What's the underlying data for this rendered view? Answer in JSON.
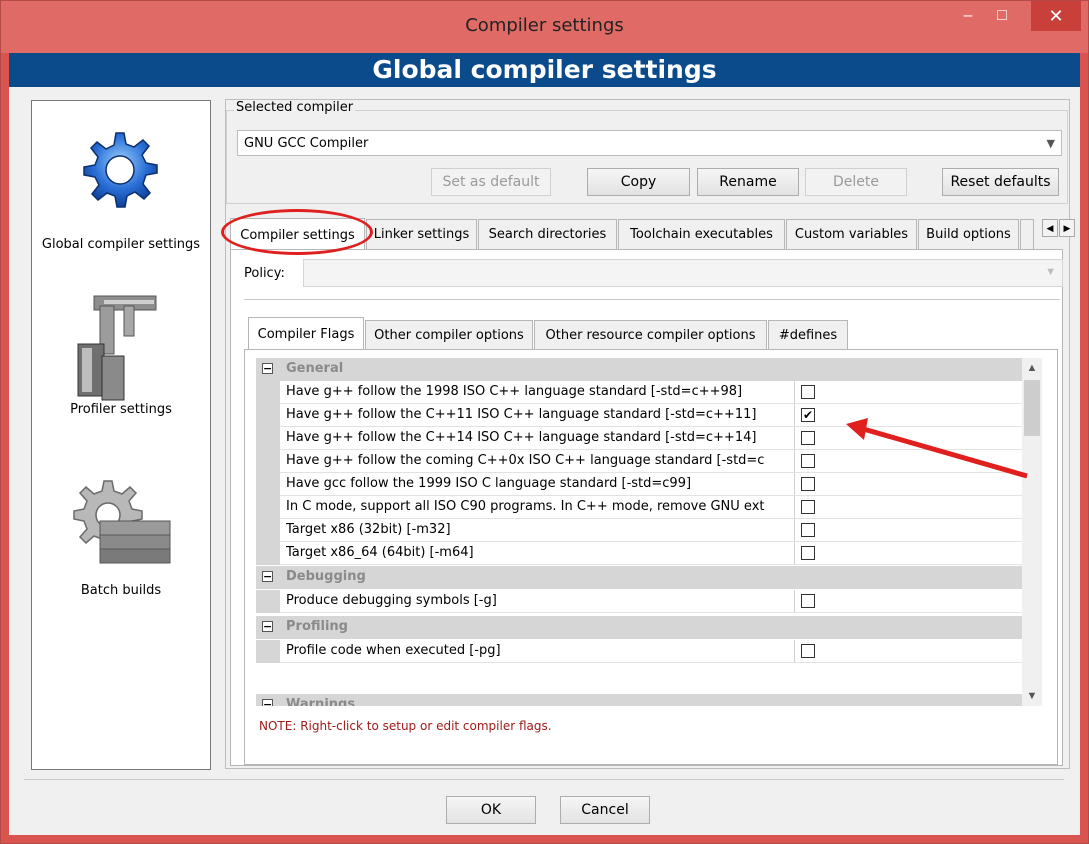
{
  "window": {
    "title": "Compiler settings",
    "header": "Global compiler settings",
    "controls": {
      "minimize": "–",
      "maximize": "□",
      "close": "✕"
    }
  },
  "sidebar": {
    "items": [
      {
        "label": "Global compiler settings",
        "icon": "gear-icon"
      },
      {
        "label": "Profiler settings",
        "icon": "caliper-icon"
      },
      {
        "label": "Batch builds",
        "icon": "gear-blocks-icon"
      }
    ]
  },
  "selected_compiler": {
    "group_label": "Selected compiler",
    "value": "GNU GCC Compiler",
    "buttons": {
      "set_default": "Set as default",
      "copy": "Copy",
      "rename": "Rename",
      "delete": "Delete",
      "reset": "Reset defaults"
    }
  },
  "tabs": [
    "Compiler settings",
    "Linker settings",
    "Search directories",
    "Toolchain executables",
    "Custom variables",
    "Build options"
  ],
  "policy": {
    "label": "Policy:",
    "value": ""
  },
  "subtabs": [
    "Compiler Flags",
    "Other compiler options",
    "Other resource compiler options",
    "#defines"
  ],
  "flags": {
    "categories": {
      "general": "General",
      "debugging": "Debugging",
      "profiling": "Profiling",
      "warnings": "Warnings"
    },
    "general": [
      {
        "name": "Have g++ follow the 1998 ISO C++ language standard  [-std=c++98]",
        "checked": false
      },
      {
        "name": "Have g++ follow the C++11 ISO C++ language standard  [-std=c++11]",
        "checked": true
      },
      {
        "name": "Have g++ follow the C++14 ISO C++ language standard  [-std=c++14]",
        "checked": false
      },
      {
        "name": "Have g++ follow the coming C++0x ISO C++ language standard  [-std=c",
        "checked": false
      },
      {
        "name": "Have gcc follow the 1999 ISO C language standard  [-std=c99]",
        "checked": false
      },
      {
        "name": "In C mode, support all ISO C90 programs. In C++ mode, remove GNU ext",
        "checked": false
      },
      {
        "name": "Target x86 (32bit)  [-m32]",
        "checked": false
      },
      {
        "name": "Target x86_64 (64bit)  [-m64]",
        "checked": false
      }
    ],
    "debugging": [
      {
        "name": "Produce debugging symbols  [-g]",
        "checked": false
      }
    ],
    "profiling": [
      {
        "name": "Profile code when executed  [-pg]",
        "checked": false
      }
    ],
    "check_mark": "✔",
    "toggle_mark": "−"
  },
  "note": "NOTE: Right-click to setup or edit compiler flags.",
  "dialog_buttons": {
    "ok": "OK",
    "cancel": "Cancel"
  },
  "annotation_color": "#e0201e"
}
